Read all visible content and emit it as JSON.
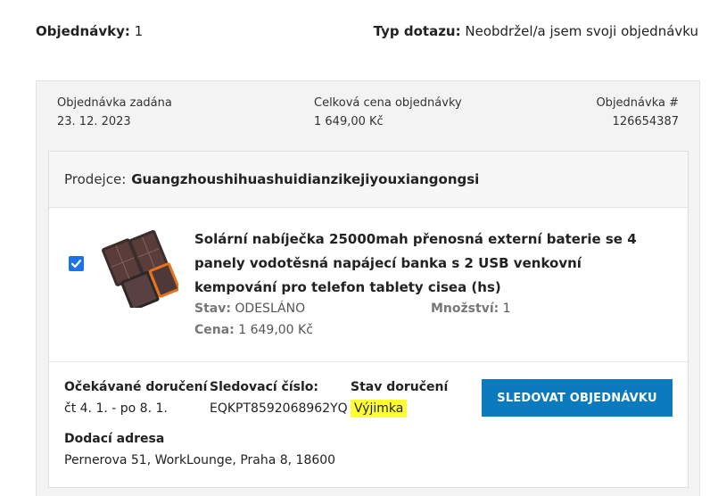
{
  "header": {
    "orders_label": "Objednávky:",
    "orders_count": "1",
    "query_type_label": "Typ dotazu:",
    "query_type_value": "Neobdržel/a jsem svoji objednávku"
  },
  "order": {
    "placed_label": "Objednávka zadána",
    "placed_value": "23. 12. 2023",
    "total_label": "Celková cena objednávky",
    "total_value": "1 649,00 Kč",
    "number_label": "Objednávka #",
    "number_value": "126654387"
  },
  "seller": {
    "label": "Prodejce:",
    "name": "Guangzhoushihuashuidianzikejiyouxiangongsi"
  },
  "item": {
    "checked": true,
    "image_icon": "solar-powerbank-image",
    "title": "Solární nabíječka 25000mah přenosná externí baterie se 4 panely vodotěsná napájecí banka s 2 USB venkovní kempování pro telefon tablety cisea (hs)",
    "status_label": "Stav:",
    "status_value": "ODESLÁNO",
    "quantity_label": "Množství:",
    "quantity_value": "1",
    "price_label": "Cena:",
    "price_value": "1 649,00 Kč"
  },
  "delivery": {
    "expected_label": "Očekávané doručení",
    "expected_value": "čt 4. 1. - po 8. 1.",
    "tracking_label": "Sledovací číslo:",
    "tracking_value": "EQKPT8592068962YQ",
    "state_label": "Stav doručení",
    "state_value": "Výjimka",
    "address_label": "Dodací adresa",
    "address_value": "Pernerova 51, WorkLounge, Praha 8, 18600",
    "track_button": "SLEDOVAT OBJEDNÁVKU"
  },
  "colors": {
    "button": "#0a7bbf",
    "highlight": "#ffff33",
    "checkbox": "#1a73e8"
  }
}
